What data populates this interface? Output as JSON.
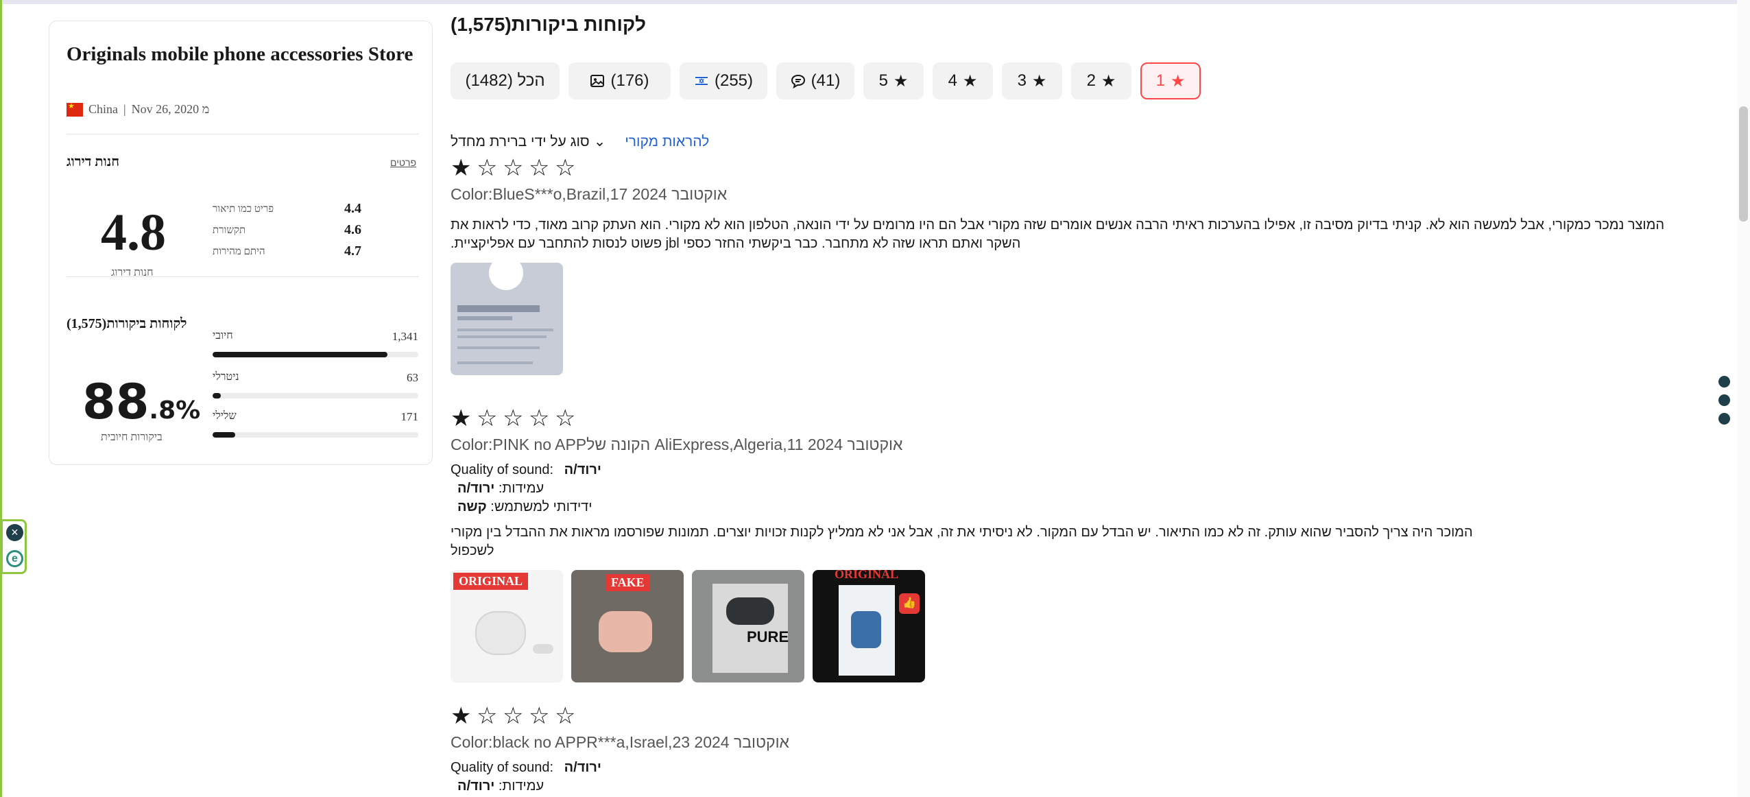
{
  "store": {
    "name": "Originals mobile phone accessories Store",
    "country": "China",
    "since": "Nov 26, 2020 מ",
    "rating_title": "חנות דירוג",
    "details_link": "פרטים",
    "rating": "4.8",
    "rating_label": "חנות דירוג",
    "metrics": [
      {
        "label": "פריט כמו תיאור",
        "value": "4.4"
      },
      {
        "label": "תקשורת",
        "value": "4.6"
      },
      {
        "label": "היתם מהירות",
        "value": "4.7"
      }
    ],
    "reviews_title": "לקוחות ביקורות(1,575)",
    "positive_pct_number": "88",
    "positive_pct_decimal": ".8%",
    "positive_label": "ביקורות חיובית",
    "sentiments": [
      {
        "label": "חיובי",
        "count": "1,341",
        "fraction": 0.85
      },
      {
        "label": "ניטרלי",
        "count": "63",
        "fraction": 0.04
      },
      {
        "label": "שלילי",
        "count": "171",
        "fraction": 0.11
      }
    ]
  },
  "reviews_header": {
    "title": "לקוחות ביקורות(1,575)",
    "filters": [
      {
        "label": "הכל (1482)",
        "icon": "none"
      },
      {
        "label": "(176)",
        "icon": "image-icon"
      },
      {
        "label": "(255)",
        "icon": "israel-flag-icon"
      },
      {
        "label": "(41)",
        "icon": "comment-icon"
      },
      {
        "label": "5",
        "icon": "star-icon"
      },
      {
        "label": "4",
        "icon": "star-icon"
      },
      {
        "label": "3",
        "icon": "star-icon"
      },
      {
        "label": "2",
        "icon": "star-icon"
      },
      {
        "label": "1",
        "icon": "star-icon",
        "active": true
      }
    ],
    "sort_label": "סוג על ידי ברירת מחדל",
    "translate_label": "להראות מקורי"
  },
  "reviews": [
    {
      "stars": 1,
      "meta": "Color:BlueS***o,Brazil,17 2024 אוקטובר",
      "text": "המוצר נמכר כמקורי, אבל למעשה הוא לא. קניתי בדיוק מסיבה זו, אפילו בהערכות ראיתי הרבה אנשים אומרים שזה מקורי אבל הם היו מרומים על ידי הונאה, הטלפון הוא לא מקורי. הוא העתק קרוב מאוד, כדי לראות את השקר ואתם תראו שזה לא מתחבר. כבר ביקשתי החזר כספי jbl פשוט לנסות להתחבר עם אפליקציית.",
      "image_labels": []
    },
    {
      "stars": 1,
      "meta": "Color:PINK no APPהקונה של AliExpress,Algeria,11 2024 אוקטובר",
      "attrs": [
        {
          "name": "Quality of sound:",
          "value": "ירוד/ה"
        },
        {
          "name": "עמידות:",
          "value": "ירוד/ה"
        },
        {
          "name": "ידידותי למשתמש:",
          "value": "קשה"
        }
      ],
      "text": "המוכר היה צריך להסביר שהוא עותק. זה לא כמו התיאור. יש הבדל עם המקור. לא ניסיתי את זה, אבל אני לא ממליץ לקנות זכויות יוצרים. תמונות שפורסמו מראות את ההבדל בין מקורי לשכפול",
      "image_labels": [
        "ORIGINAL",
        "FAKE",
        "PURE",
        "ORIGINAL"
      ]
    },
    {
      "stars": 1,
      "meta": "Color:black no APPR***a,Israel,23 2024 אוקטובר",
      "attrs": [
        {
          "name": "Quality of sound:",
          "value": "ירוד/ה"
        },
        {
          "name": "עמידות:",
          "value": "ירוד/ה"
        }
      ]
    }
  ],
  "colors": {
    "accent": "#ff4747",
    "link": "#2161d6",
    "text": "#191919"
  }
}
